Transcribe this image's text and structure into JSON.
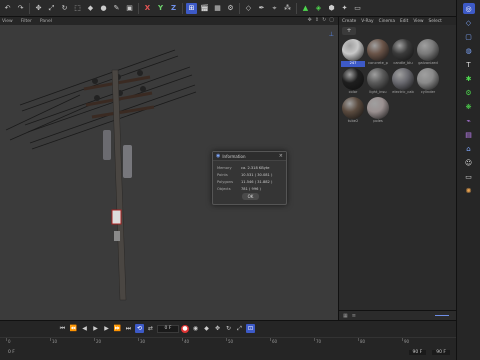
{
  "app": {
    "name": "Cinema 4D"
  },
  "toolbar": {
    "x_label": "X",
    "y_label": "Y",
    "z_label": "Z"
  },
  "viewport": {
    "menu": [
      "View",
      "Filter",
      "Panel"
    ]
  },
  "materials": {
    "menu": [
      "Create",
      "V-Ray",
      "Cinema",
      "Edit",
      "View",
      "Select"
    ],
    "add_button": "+",
    "items": [
      {
        "name": "247",
        "color": "#c8c8c8",
        "selected": true
      },
      {
        "name": "concrete_p",
        "color": "#6a5448"
      },
      {
        "name": "candle_blu",
        "color": "#3a3a3a"
      },
      {
        "name": "galvanized",
        "color": "#7a7a7a"
      },
      {
        "name": "color",
        "color": "#1e1e1e"
      },
      {
        "name": "light_insu",
        "color": "#5a5a5a"
      },
      {
        "name": "electric_cab",
        "color": "#6a6a70"
      },
      {
        "name": "cylinder",
        "color": "#8a8a8a"
      },
      {
        "name": "tube2",
        "color": "#5a4a3e"
      },
      {
        "name": "poles",
        "color": "#9a9090"
      }
    ]
  },
  "dialog": {
    "title": "Information",
    "close": "×",
    "rows": [
      {
        "label": "Memory",
        "value": "ca. 2.318 KByte"
      },
      {
        "label": "Points",
        "value": "10.531 ( 30.081 )"
      },
      {
        "label": "Polygons",
        "value": "11.546 ( 31.882 )"
      },
      {
        "label": "Objects",
        "value": "781 ( 996 )"
      }
    ],
    "ok_label": "OK"
  },
  "timeline": {
    "current_frame": "0 F",
    "ticks": [
      "0",
      "10",
      "20",
      "30",
      "40",
      "50",
      "60",
      "70",
      "80",
      "90"
    ],
    "min_frame": "0 F",
    "end_frame": "90 F",
    "max_frame": "90 F"
  }
}
